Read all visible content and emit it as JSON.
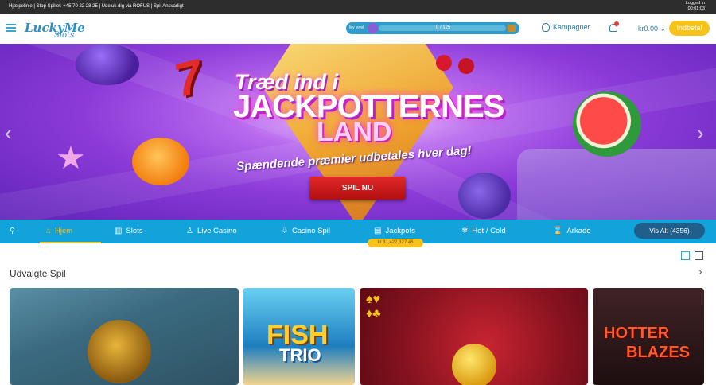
{
  "topbar": {
    "links": "Hjælpelinje | Stop Spillet: +45 70 22 28 25 | Udeluk dig via ROFUS | Spil Ansvarligt",
    "logged_in_label": "Logged in",
    "logged_in_time": "00:01:03"
  },
  "header": {
    "logo_line1": "LuckyMe",
    "logo_line2": "Slots",
    "level_label": "My level",
    "level_progress": "0 / 125",
    "kampagner": "Kampagner",
    "balance": "kr0.00",
    "deposit_button": "Indbetal"
  },
  "hero": {
    "headline1": "Træd ind i",
    "headline2": "JACKPOTTERNES",
    "headline3": "LAND",
    "subheadline": "Spændende præmier udbetales hver dag!",
    "cta": "SPIL NU"
  },
  "nav": {
    "items": [
      {
        "label": "Hjem",
        "icon": "home-icon",
        "active": true
      },
      {
        "label": "Slots",
        "icon": "slots-icon",
        "active": false
      },
      {
        "label": "Live Casino",
        "icon": "live-casino-icon",
        "active": false
      },
      {
        "label": "Casino Spil",
        "icon": "casino-spil-icon",
        "active": false
      },
      {
        "label": "Jackpots",
        "icon": "jackpots-icon",
        "active": false
      },
      {
        "label": "Hot / Cold",
        "icon": "hot-cold-icon",
        "active": false
      },
      {
        "label": "Arkade",
        "icon": "arkade-icon",
        "active": false
      }
    ],
    "jackpot_amount": "kr 31,422,327.46",
    "view_all": "Vis Alt (4356)"
  },
  "featured": {
    "title": "Udvalgte Spil",
    "games": [
      {
        "name": "",
        "text": ""
      },
      {
        "name": "FISH",
        "text": "TRIO"
      },
      {
        "name": "",
        "text": ""
      },
      {
        "name": "HOTTER",
        "text": "BLAZES"
      }
    ]
  },
  "colors": {
    "brand_blue": "#12a3da",
    "accent_yellow": "#f6c21c",
    "cta_red": "#d21d1d"
  }
}
